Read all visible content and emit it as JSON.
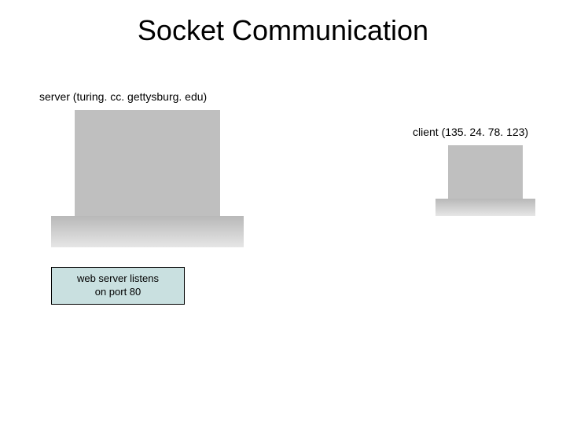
{
  "title": "Socket Communication",
  "server_label": "server (turing. cc. gettysburg. edu)",
  "client_label": "client (135. 24. 78. 123)",
  "port_box": "web server listens\non port 80"
}
